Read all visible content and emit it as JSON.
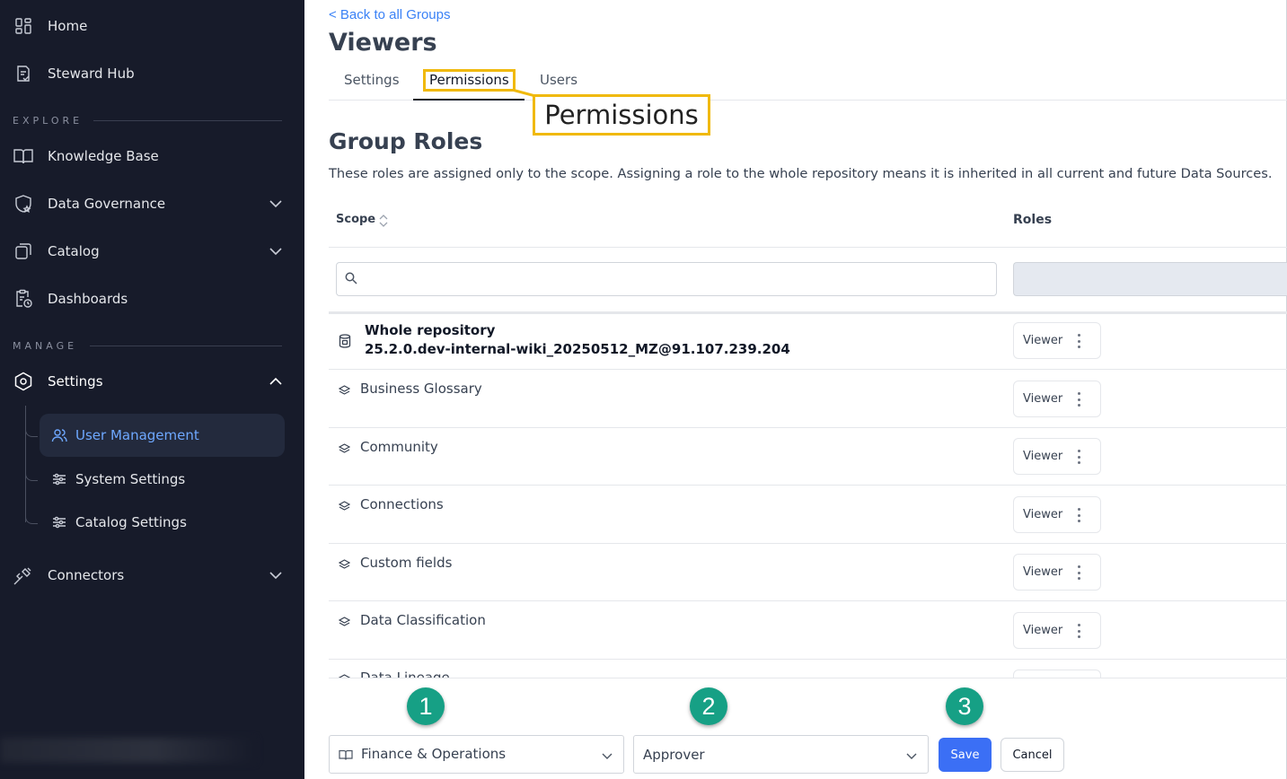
{
  "sidebar": {
    "items": [
      {
        "label": "Home",
        "icon": "grid-icon"
      },
      {
        "label": "Steward Hub",
        "icon": "document-check-icon"
      },
      {
        "label": "Knowledge Base",
        "icon": "book-icon"
      },
      {
        "label": "Data Governance",
        "icon": "shield-star-icon"
      },
      {
        "label": "Catalog",
        "icon": "copy-icon"
      },
      {
        "label": "Dashboards",
        "icon": "clipboard-clock-icon"
      },
      {
        "label": "Settings",
        "icon": "hexagon-cog-icon"
      },
      {
        "label": "Connectors",
        "icon": "plug-icon"
      }
    ],
    "sections": {
      "explore": "EXPLORE",
      "manage": "MANAGE"
    },
    "settings_sub": [
      {
        "label": "User Management",
        "icon": "users-icon"
      },
      {
        "label": "System Settings",
        "icon": "sliders-icon"
      },
      {
        "label": "Catalog Settings",
        "icon": "sliders-icon"
      }
    ]
  },
  "header": {
    "back_link": "< Back to all Groups",
    "title": "Viewers",
    "tabs": [
      {
        "label": "Settings"
      },
      {
        "label": "Permissions"
      },
      {
        "label": "Users"
      }
    ],
    "callout": "Permissions"
  },
  "group_roles": {
    "title": "Group Roles",
    "description": "These roles are assigned only to the scope. Assigning a role to the whole repository means it is inherited in all current and future Data Sources.",
    "columns": {
      "scope": "Scope",
      "roles": "Roles"
    },
    "search_placeholder": "",
    "repository": {
      "title": "Whole repository",
      "subtitle": "25.2.0.dev-internal-wiki_20250512_MZ@91.107.239.204",
      "role": "Viewer"
    },
    "rows": [
      {
        "name": "Business Glossary",
        "role": "Viewer"
      },
      {
        "name": "Community",
        "role": "Viewer"
      },
      {
        "name": "Connections",
        "role": "Viewer"
      },
      {
        "name": "Custom fields",
        "role": "Viewer"
      },
      {
        "name": "Data Classification",
        "role": "Viewer"
      },
      {
        "name": "Data Lineage",
        "role": "Viewer"
      }
    ]
  },
  "footer": {
    "scope_select": "Finance & Operations",
    "role_select": "Approver",
    "save_label": "Save",
    "cancel_label": "Cancel",
    "steps": [
      "1",
      "2",
      "3"
    ]
  },
  "colors": {
    "sidebar_bg": "#171b2a",
    "accent": "#3b6ff5",
    "highlight": "#f0b90b",
    "step_badge": "#16a085",
    "link": "#3b82f6"
  }
}
